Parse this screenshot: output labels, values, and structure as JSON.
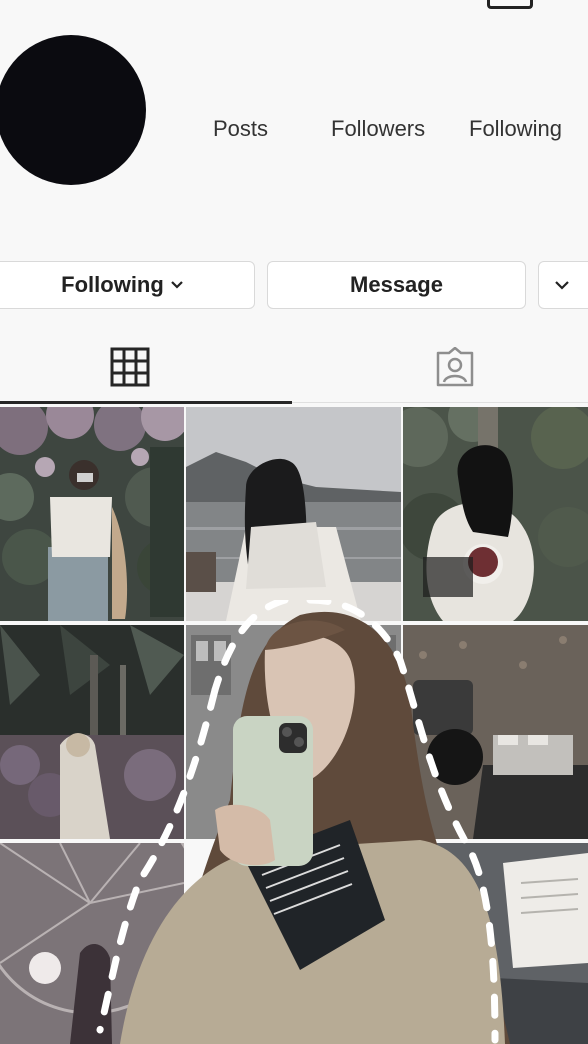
{
  "profile": {
    "stats": [
      {
        "label": "Posts"
      },
      {
        "label": "Followers"
      },
      {
        "label": "Following"
      }
    ]
  },
  "actions": {
    "following_label": "Following",
    "message_label": "Message"
  },
  "tabs": [
    {
      "icon": "grid-icon",
      "active": true
    },
    {
      "icon": "tagged-person-icon",
      "active": false
    }
  ],
  "grid": [
    {
      "name": "post-woman-camera-flowers"
    },
    {
      "name": "post-woman-lake-dock"
    },
    {
      "name": "post-woman-strawberries"
    },
    {
      "name": "post-palm-trees"
    },
    {
      "name": "post-building-window"
    },
    {
      "name": "post-record-player-shoes"
    },
    {
      "name": "post-ferris-wheel"
    },
    {
      "name": "post-book-blanket"
    }
  ],
  "overlay": {
    "name": "mirror-selfie-woman-with-phone"
  },
  "colors": {
    "background": "#f8f8f8",
    "avatar": "#0b0b10",
    "text": "#222222"
  }
}
